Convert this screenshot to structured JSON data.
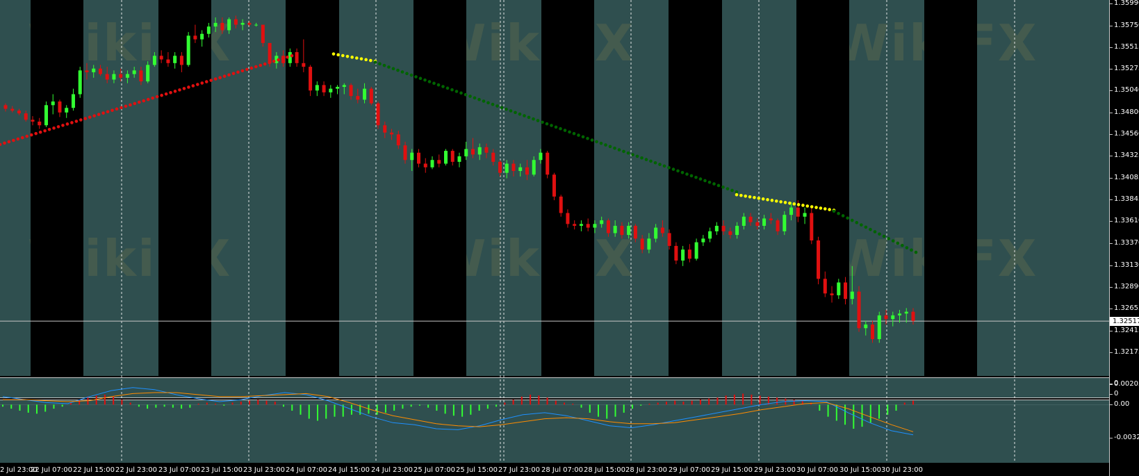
{
  "app": {
    "title": "MetaTrader chart"
  },
  "colors": {
    "background": "#000000",
    "session_band": "#2f4f4f",
    "bull_candle": "#32ff32",
    "bear_candle": "#e01010",
    "trail_up": "#e01010",
    "trail_neutral": "#ffff00",
    "trail_down": "#006400",
    "macd_pos": "#e01010",
    "macd_neg": "#32ff32",
    "macd_line": "#1e90ff",
    "signal_line": "#ff8c00",
    "price_line": "#c8c8c8",
    "grid_vertical": "#ffffff"
  },
  "price_axis": {
    "ticks": [
      "1.35990",
      "1.35750",
      "1.35515",
      "1.35275",
      "1.35040",
      "1.34800",
      "1.34560",
      "1.34325",
      "1.34085",
      "1.33845",
      "1.33610",
      "1.33370",
      "1.33130",
      "1.32890",
      "1.32655",
      "1.32415",
      "1.32175"
    ],
    "current_price": "1.32517"
  },
  "mid_axis": {
    "ticks": [
      "0",
      "0"
    ]
  },
  "osc_axis": {
    "ticks": [
      "0.0020558",
      "0.00",
      "-0.003298"
    ]
  },
  "time_axis": {
    "labels": [
      "2 Jul 23:00",
      "22 Jul 07:00",
      "22 Jul 15:00",
      "22 Jul 23:00",
      "23 Jul 07:00",
      "23 Jul 15:00",
      "23 Jul 23:00",
      "24 Jul 07:00",
      "24 Jul 15:00",
      "24 Jul 23:00",
      "25 Jul 07:00",
      "25 Jul 15:00",
      "27 Jul 23:00",
      "28 Jul 07:00",
      "28 Jul 15:00",
      "28 Jul 23:00",
      "29 Jul 07:00",
      "29 Jul 15:00",
      "29 Jul 23:00",
      "30 Jul 07:00",
      "30 Jul 15:00",
      "30 Jul 23:00"
    ]
  },
  "watermark": {
    "text": "WikiFX"
  },
  "chart_data": {
    "type": "candlestick",
    "ylim": [
      1.321,
      1.36
    ],
    "candles_ohlc": [
      [
        1.3488,
        1.349,
        1.3481,
        1.3484
      ],
      [
        1.3484,
        1.3487,
        1.348,
        1.3482
      ],
      [
        1.3482,
        1.3484,
        1.3477,
        1.3479
      ],
      [
        1.3479,
        1.3482,
        1.347,
        1.3472
      ],
      [
        1.3472,
        1.3476,
        1.3466,
        1.347
      ],
      [
        1.347,
        1.3474,
        1.3462,
        1.3466
      ],
      [
        1.3466,
        1.3492,
        1.3464,
        1.3488
      ],
      [
        1.3488,
        1.35,
        1.3478,
        1.3492
      ],
      [
        1.3492,
        1.3494,
        1.3475,
        1.348
      ],
      [
        1.348,
        1.3488,
        1.3474,
        1.3485
      ],
      [
        1.3485,
        1.3506,
        1.3482,
        1.35
      ],
      [
        1.35,
        1.353,
        1.3496,
        1.3526
      ],
      [
        1.3526,
        1.3534,
        1.3516,
        1.3524
      ],
      [
        1.3524,
        1.3532,
        1.3518,
        1.3528
      ],
      [
        1.3528,
        1.3532,
        1.352,
        1.3522
      ],
      [
        1.3522,
        1.353,
        1.3512,
        1.3516
      ],
      [
        1.3516,
        1.3526,
        1.3512,
        1.3522
      ],
      [
        1.3522,
        1.3528,
        1.3514,
        1.3518
      ],
      [
        1.3518,
        1.3526,
        1.3512,
        1.3522
      ],
      [
        1.3522,
        1.353,
        1.3518,
        1.3526
      ],
      [
        1.3526,
        1.353,
        1.351,
        1.3514
      ],
      [
        1.3514,
        1.3536,
        1.3512,
        1.3532
      ],
      [
        1.3532,
        1.3546,
        1.353,
        1.3542
      ],
      [
        1.3542,
        1.3548,
        1.3534,
        1.3538
      ],
      [
        1.3538,
        1.3546,
        1.353,
        1.3534
      ],
      [
        1.3534,
        1.3546,
        1.3528,
        1.3542
      ],
      [
        1.3542,
        1.3546,
        1.3524,
        1.3532
      ],
      [
        1.3532,
        1.3568,
        1.353,
        1.3564
      ],
      [
        1.3564,
        1.3576,
        1.3556,
        1.356
      ],
      [
        1.356,
        1.357,
        1.3552,
        1.3566
      ],
      [
        1.3566,
        1.3578,
        1.3562,
        1.3574
      ],
      [
        1.3574,
        1.3584,
        1.3568,
        1.3578
      ],
      [
        1.3578,
        1.3584,
        1.3566,
        1.357
      ],
      [
        1.357,
        1.3584,
        1.3566,
        1.3582
      ],
      [
        1.3582,
        1.3586,
        1.3572,
        1.3576
      ],
      [
        1.3576,
        1.3582,
        1.357,
        1.3578
      ],
      [
        1.3578,
        1.358,
        1.3574,
        1.3576
      ],
      [
        1.3576,
        1.3578,
        1.3574,
        1.3576
      ],
      [
        1.3576,
        1.3576,
        1.3552,
        1.3556
      ],
      [
        1.3556,
        1.3556,
        1.353,
        1.3534
      ],
      [
        1.3534,
        1.3546,
        1.3528,
        1.3542
      ],
      [
        1.3542,
        1.3548,
        1.353,
        1.3534
      ],
      [
        1.3534,
        1.355,
        1.353,
        1.3546
      ],
      [
        1.3546,
        1.355,
        1.353,
        1.3534
      ],
      [
        1.3534,
        1.356,
        1.3524,
        1.353
      ],
      [
        1.353,
        1.3532,
        1.3498,
        1.3504
      ],
      [
        1.3504,
        1.3514,
        1.3498,
        1.351
      ],
      [
        1.351,
        1.3514,
        1.3498,
        1.3502
      ],
      [
        1.3502,
        1.351,
        1.3496,
        1.3506
      ],
      [
        1.3506,
        1.351,
        1.35,
        1.3508
      ],
      [
        1.3508,
        1.3512,
        1.35,
        1.351
      ],
      [
        1.351,
        1.3512,
        1.3494,
        1.3498
      ],
      [
        1.3498,
        1.3506,
        1.349,
        1.3494
      ],
      [
        1.3494,
        1.3512,
        1.349,
        1.3506
      ],
      [
        1.3506,
        1.3508,
        1.3488,
        1.349
      ],
      [
        1.349,
        1.3492,
        1.3462,
        1.3466
      ],
      [
        1.3466,
        1.347,
        1.3452,
        1.3458
      ],
      [
        1.3458,
        1.3462,
        1.345,
        1.3456
      ],
      [
        1.3456,
        1.346,
        1.344,
        1.3444
      ],
      [
        1.3444,
        1.3448,
        1.3424,
        1.3428
      ],
      [
        1.3428,
        1.344,
        1.3416,
        1.3436
      ],
      [
        1.3436,
        1.344,
        1.342,
        1.3424
      ],
      [
        1.3424,
        1.343,
        1.3414,
        1.342
      ],
      [
        1.342,
        1.3432,
        1.3418,
        1.3428
      ],
      [
        1.3428,
        1.3434,
        1.342,
        1.3424
      ],
      [
        1.3424,
        1.344,
        1.3422,
        1.3438
      ],
      [
        1.3438,
        1.344,
        1.3422,
        1.3426
      ],
      [
        1.3426,
        1.3436,
        1.342,
        1.3432
      ],
      [
        1.3432,
        1.3448,
        1.3428,
        1.344
      ],
      [
        1.344,
        1.3452,
        1.343,
        1.3434
      ],
      [
        1.3434,
        1.3446,
        1.3428,
        1.3442
      ],
      [
        1.3442,
        1.3446,
        1.343,
        1.3436
      ],
      [
        1.3436,
        1.344,
        1.3422,
        1.3426
      ],
      [
        1.3426,
        1.3428,
        1.341,
        1.3414
      ],
      [
        1.3414,
        1.3428,
        1.3408,
        1.3424
      ],
      [
        1.3424,
        1.3428,
        1.341,
        1.3416
      ],
      [
        1.3416,
        1.3424,
        1.341,
        1.342
      ],
      [
        1.342,
        1.3428,
        1.3406,
        1.3412
      ],
      [
        1.3412,
        1.3432,
        1.341,
        1.3428
      ],
      [
        1.3428,
        1.344,
        1.3424,
        1.3436
      ],
      [
        1.3436,
        1.3438,
        1.3408,
        1.3412
      ],
      [
        1.3412,
        1.3414,
        1.3384,
        1.3388
      ],
      [
        1.3388,
        1.339,
        1.3366,
        1.337
      ],
      [
        1.337,
        1.3374,
        1.3354,
        1.3358
      ],
      [
        1.3358,
        1.3362,
        1.3352,
        1.3356
      ],
      [
        1.3356,
        1.3362,
        1.335,
        1.3358
      ],
      [
        1.3358,
        1.3364,
        1.335,
        1.3354
      ],
      [
        1.3354,
        1.3362,
        1.3348,
        1.3358
      ],
      [
        1.3358,
        1.3366,
        1.3354,
        1.3362
      ],
      [
        1.3362,
        1.3364,
        1.3344,
        1.3348
      ],
      [
        1.3348,
        1.3362,
        1.3344,
        1.3356
      ],
      [
        1.3356,
        1.336,
        1.3342,
        1.3346
      ],
      [
        1.3346,
        1.336,
        1.3342,
        1.3356
      ],
      [
        1.3356,
        1.3358,
        1.3338,
        1.3342
      ],
      [
        1.3342,
        1.3346,
        1.3326,
        1.333
      ],
      [
        1.333,
        1.3348,
        1.3326,
        1.3342
      ],
      [
        1.3342,
        1.3358,
        1.3338,
        1.3354
      ],
      [
        1.3354,
        1.3362,
        1.3344,
        1.3348
      ],
      [
        1.3348,
        1.3352,
        1.333,
        1.3334
      ],
      [
        1.3334,
        1.3338,
        1.3314,
        1.3318
      ],
      [
        1.3318,
        1.3334,
        1.3312,
        1.333
      ],
      [
        1.333,
        1.3336,
        1.3316,
        1.332
      ],
      [
        1.332,
        1.3342,
        1.3318,
        1.3338
      ],
      [
        1.3338,
        1.3346,
        1.3334,
        1.3342
      ],
      [
        1.3342,
        1.3354,
        1.3338,
        1.335
      ],
      [
        1.335,
        1.336,
        1.3346,
        1.3356
      ],
      [
        1.3356,
        1.3362,
        1.3346,
        1.335
      ],
      [
        1.335,
        1.3354,
        1.3342,
        1.3346
      ],
      [
        1.3346,
        1.336,
        1.3342,
        1.3356
      ],
      [
        1.3356,
        1.337,
        1.3352,
        1.3366
      ],
      [
        1.3366,
        1.337,
        1.3356,
        1.336
      ],
      [
        1.336,
        1.3364,
        1.3352,
        1.3356
      ],
      [
        1.3356,
        1.3368,
        1.3352,
        1.3364
      ],
      [
        1.3364,
        1.337,
        1.3358,
        1.3362
      ],
      [
        1.3362,
        1.3364,
        1.3346,
        1.335
      ],
      [
        1.335,
        1.3372,
        1.3346,
        1.3368
      ],
      [
        1.3368,
        1.3382,
        1.3362,
        1.3376
      ],
      [
        1.3376,
        1.3384,
        1.336,
        1.3366
      ],
      [
        1.3366,
        1.3376,
        1.3358,
        1.337
      ],
      [
        1.337,
        1.3378,
        1.3336,
        1.334
      ],
      [
        1.334,
        1.3344,
        1.3292,
        1.3298
      ],
      [
        1.3298,
        1.3306,
        1.3278,
        1.3282
      ],
      [
        1.3282,
        1.329,
        1.3272,
        1.328
      ],
      [
        1.328,
        1.3298,
        1.3276,
        1.3294
      ],
      [
        1.3294,
        1.33,
        1.327,
        1.3276
      ],
      [
        1.3276,
        1.3312,
        1.327,
        1.3284
      ],
      [
        1.3284,
        1.329,
        1.324,
        1.3244
      ],
      [
        1.3244,
        1.3252,
        1.3236,
        1.3248
      ],
      [
        1.3248,
        1.3252,
        1.3228,
        1.3232
      ],
      [
        1.3232,
        1.3262,
        1.3228,
        1.3258
      ],
      [
        1.3258,
        1.3264,
        1.3248,
        1.3254
      ],
      [
        1.3254,
        1.3262,
        1.3246,
        1.3258
      ],
      [
        1.3258,
        1.3264,
        1.325,
        1.326
      ],
      [
        1.326,
        1.3266,
        1.325,
        1.3262
      ],
      [
        1.3262,
        1.3266,
        1.3248,
        1.3252
      ]
    ],
    "trail": [
      {
        "from": 1.3445,
        "to": 1.3542,
        "state": "up"
      },
      {
        "from": 1.3544,
        "to": 1.3536,
        "state": "neutral"
      },
      {
        "from": 1.3535,
        "to": 1.3393,
        "state": "down"
      },
      {
        "from": 1.339,
        "to": 1.3373,
        "state": "neutral"
      },
      {
        "from": 1.3372,
        "to": 1.3327,
        "state": "down"
      }
    ],
    "oscillator": {
      "ylim": [
        -0.0033,
        0.0021
      ],
      "histogram": [
        -0.0002,
        -0.0004,
        -0.0006,
        -0.0008,
        -0.0009,
        -0.0007,
        -0.0004,
        -0.0002,
        0.0002,
        0.0005,
        0.0008,
        0.0009,
        0.001,
        0.0008,
        0.0005,
        0.0002,
        -0.0002,
        -0.0004,
        -0.0003,
        -0.0002,
        -0.0003,
        -0.0004,
        -0.0003,
        0.0001,
        0.0002,
        0.0001,
        -0.0001,
        0.0002,
        0.0003,
        0.0004,
        0.0005,
        0.0004,
        0.0003,
        -0.0002,
        -0.0006,
        -0.001,
        -0.0014,
        -0.0016,
        -0.0014,
        -0.0012,
        -0.0012,
        -0.001,
        -0.001,
        -0.0009,
        -0.001,
        -0.0008,
        -0.0006,
        -0.0004,
        -0.0002,
        -0.0001,
        -0.0003,
        -0.0006,
        -0.0009,
        -0.0011,
        -0.0012,
        -0.001,
        -0.0006,
        -0.0004,
        -0.0002,
        0.0002,
        0.0005,
        0.0008,
        0.001,
        0.0009,
        0.0007,
        0.0004,
        0.0002,
        0.0001,
        -0.0003,
        -0.0008,
        -0.0012,
        -0.0014,
        -0.0012,
        -0.0008,
        -0.0004,
        -0.0001,
        0.0001,
        0.0002,
        0.0003,
        0.0004,
        0.0003,
        0.0004,
        0.0005,
        0.0006,
        0.0007,
        0.0009,
        0.001,
        0.0011,
        0.001,
        0.0009,
        0.0008,
        0.0007,
        0.0006,
        0.0005,
        0.0004,
        0.0002,
        -0.0006,
        -0.0012,
        -0.0016,
        -0.002,
        -0.0024,
        -0.0022,
        -0.0018,
        -0.0014,
        -0.001,
        -0.0006,
        0.0002,
        0.0004
      ],
      "macd_line": [
        0.0008,
        0.0005,
        0.0002,
        0.0001,
        0.0008,
        0.0014,
        0.0017,
        0.0015,
        0.001,
        0.0006,
        0.0003,
        0.0005,
        0.0009,
        0.0012,
        0.001,
        0.0004,
        -0.0004,
        -0.0012,
        -0.0018,
        -0.002,
        -0.0024,
        -0.0025,
        -0.0021,
        -0.0015,
        -0.001,
        -0.0008,
        -0.0011,
        -0.0016,
        -0.0021,
        -0.0023,
        -0.002,
        -0.0016,
        -0.0012,
        -0.0008,
        -0.0004,
        0.0,
        0.0003,
        0.0004,
        0.0003,
        -0.0008,
        -0.0018,
        -0.0026,
        -0.003
      ],
      "signal_line": [
        0.0005,
        0.0005,
        0.0004,
        0.0003,
        0.0004,
        0.0008,
        0.0011,
        0.0012,
        0.0012,
        0.001,
        0.0008,
        0.0008,
        0.0009,
        0.001,
        0.0011,
        0.0008,
        0.0002,
        -0.0005,
        -0.0011,
        -0.0015,
        -0.0019,
        -0.0021,
        -0.0022,
        -0.002,
        -0.0017,
        -0.0014,
        -0.0013,
        -0.0014,
        -0.0017,
        -0.0019,
        -0.0019,
        -0.0018,
        -0.0015,
        -0.0012,
        -0.0009,
        -0.0005,
        -0.0002,
        0.0001,
        0.0002,
        -0.0004,
        -0.0012,
        -0.002,
        -0.0027
      ]
    }
  }
}
